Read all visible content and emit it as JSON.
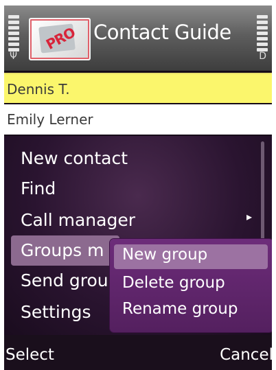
{
  "app": {
    "title": "Contact Guide",
    "logo_text": "PRO"
  },
  "status": {
    "signal_glyph": "Ψ",
    "battery_glyph": "D"
  },
  "contacts": [
    {
      "name": "Dennis T.",
      "selected": true
    },
    {
      "name": "Emily Lerner",
      "selected": false
    }
  ],
  "menu": {
    "items": [
      {
        "label": "New contact"
      },
      {
        "label": "Find"
      },
      {
        "label": "Call manager",
        "has_submenu": true
      },
      {
        "label": "Groups m",
        "highlighted": true
      },
      {
        "label": "Send grou"
      },
      {
        "label": "Settings"
      }
    ],
    "submenu_arrow": "▸"
  },
  "submenu": {
    "items": [
      {
        "label": "New group",
        "highlighted": true
      },
      {
        "label": "Delete group"
      },
      {
        "label": "Rename group"
      }
    ]
  },
  "softkeys": {
    "left": "Select",
    "right": "Cancel"
  },
  "colors": {
    "selected_row": "#fbf66c",
    "menu_highlight": "#8c6a8f",
    "submenu_bg": "#6d2c7a",
    "submenu_highlight": "#9c72a2"
  }
}
